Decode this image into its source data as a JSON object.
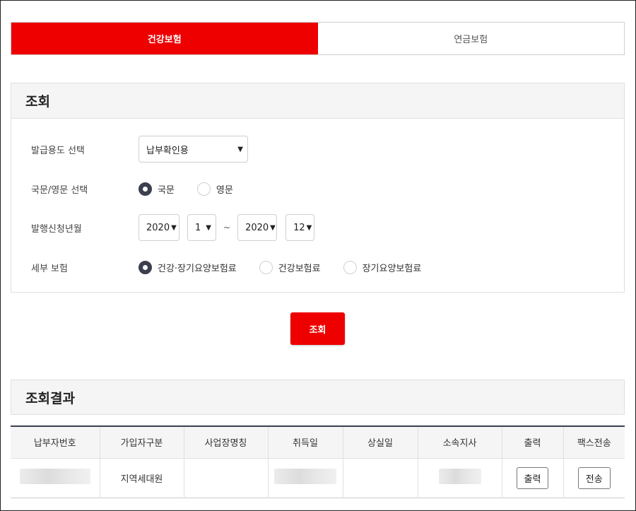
{
  "tabs": [
    {
      "label": "건강보험",
      "active": true
    },
    {
      "label": "연금보험",
      "active": false
    }
  ],
  "query": {
    "title": "조회",
    "purpose": {
      "label": "발급용도 선택",
      "value": "납부확인용"
    },
    "language": {
      "label": "국문/영문 선택",
      "options": [
        "국문",
        "영문"
      ],
      "selected": "국문"
    },
    "period": {
      "label": "발행신청년월",
      "from_year": "2020",
      "from_month": "1",
      "separator": "~",
      "to_year": "2020",
      "to_month": "12"
    },
    "insurance_detail": {
      "label": "세부 보험",
      "options": [
        "건강·장기요양보험료",
        "건강보험료",
        "장기요양보험료"
      ],
      "selected": "건강·장기요양보험료"
    },
    "search_label": "조회"
  },
  "results": {
    "title": "조회결과",
    "columns": [
      "납부자번호",
      "가입자구분",
      "사업장명칭",
      "취득일",
      "상실일",
      "소속지사",
      "출력",
      "팩스전송"
    ],
    "rows": [
      {
        "subscriber_type": "지역세대원",
        "print_label": "출력",
        "fax_label": "전송"
      }
    ]
  },
  "colors": {
    "accent": "#ee0000",
    "radio_on": "#3b3f4e"
  }
}
